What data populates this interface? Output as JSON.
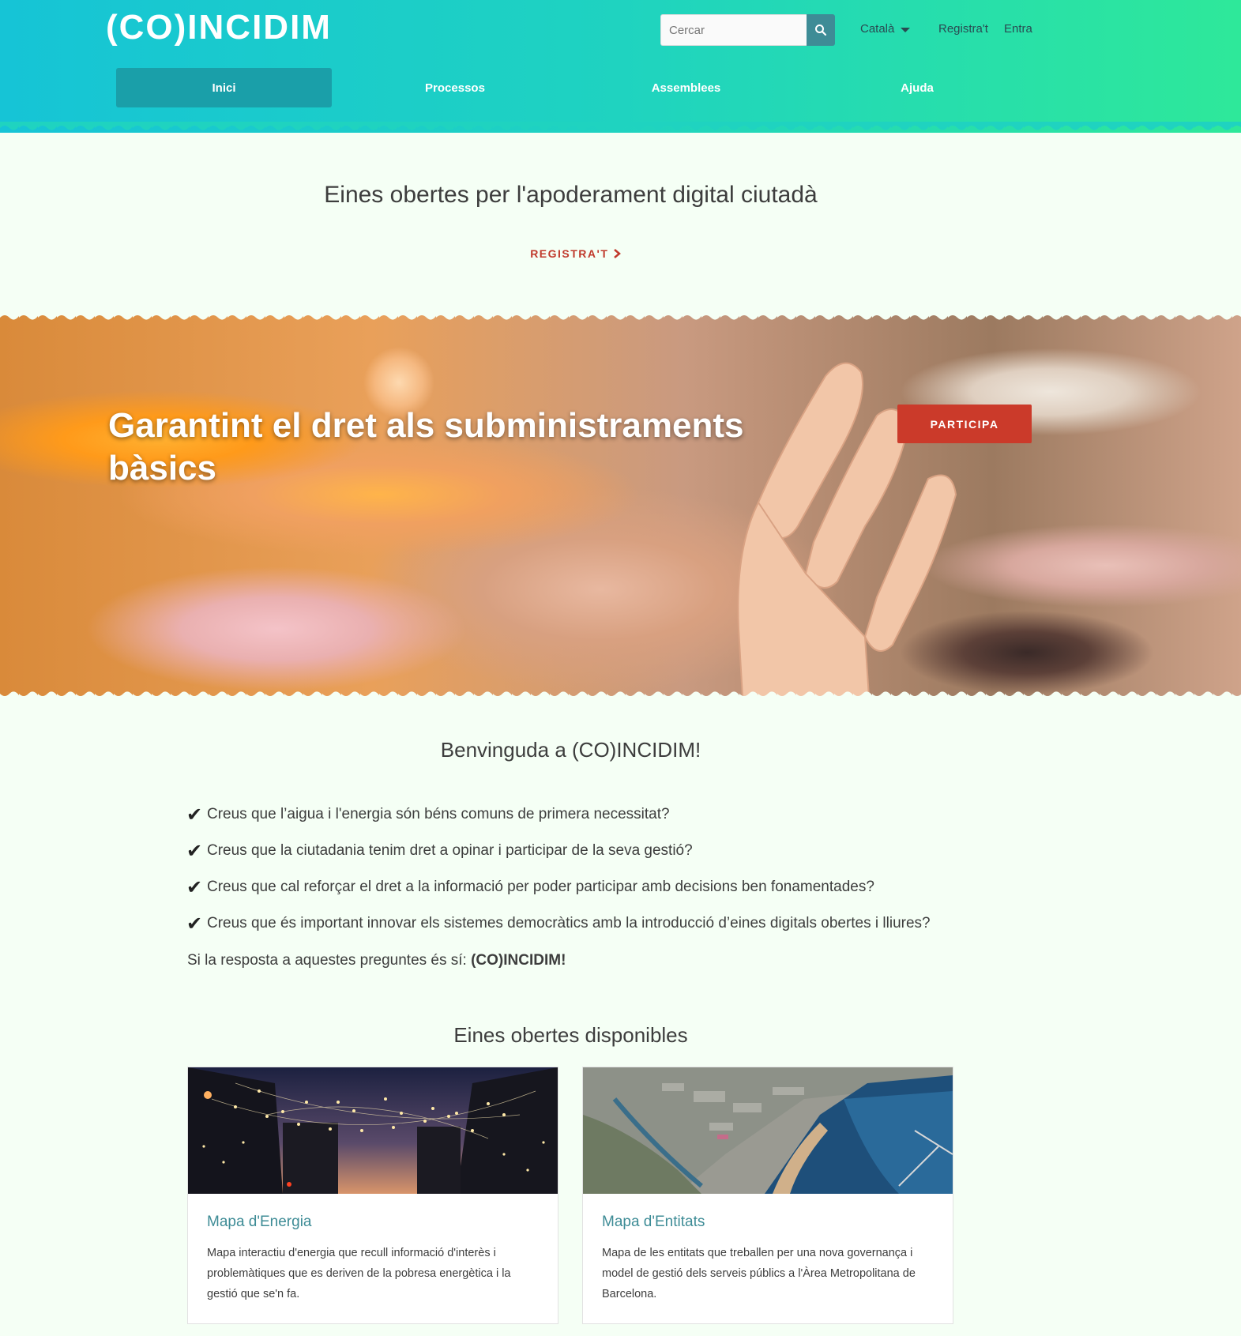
{
  "header": {
    "logo_text": "(CO)INCIDIM",
    "search": {
      "placeholder": "Cercar"
    },
    "language": "Català",
    "register_label": "Registra't",
    "login_label": "Entra",
    "nav": [
      {
        "label": "Inici"
      },
      {
        "label": "Processos"
      },
      {
        "label": "Assemblees"
      },
      {
        "label": "Ajuda"
      }
    ]
  },
  "intro": {
    "tagline": "Eines obertes per l'apoderament digital ciutadà",
    "register_cta": "REGISTRA'T"
  },
  "hero": {
    "title": "Garantint el dret als subministraments bàsics",
    "button": "PARTICIPA"
  },
  "welcome": {
    "title": "Benvinguda a (CO)INCIDIM!",
    "questions": [
      "Creus que l’aigua i l'energia són béns comuns de primera necessitat?",
      "Creus que la ciutadania tenim dret a opinar i participar de la seva gestió?",
      "Creus que cal reforçar el dret a la informació per poder participar amb decisions ben fonamentades?",
      "Creus que és important innovar els sistemes democràtics amb la introducció d’eines digitals obertes i lliures?"
    ],
    "answer_prefix": "Si la resposta a aquestes preguntes és sí: ",
    "answer_bold": "(CO)INCIDIM!"
  },
  "tools": {
    "title": "Eines obertes disponibles",
    "cards": [
      {
        "title": "Mapa d'Energia",
        "description": "Mapa interactiu d'energia que recull informació d'interès i problemàtiques que es deriven de la pobresa energètica i la gestió que se'n fa."
      },
      {
        "title": "Mapa d'Entitats",
        "description": "Mapa de les entitats que treballen per una nova governança i model de gestió dels serveis públics a l'Àrea Metropolitana de Barcelona."
      }
    ]
  },
  "colors": {
    "header_gradient_start": "#16c4d6",
    "header_gradient_end": "#2ee89a",
    "accent_red": "#cb3a2a",
    "link_teal": "#3e8c96",
    "page_background": "#f5fff5"
  },
  "icons": [
    "search-icon",
    "caret-down-icon",
    "chevron-right-icon",
    "checkmark-icon"
  ]
}
